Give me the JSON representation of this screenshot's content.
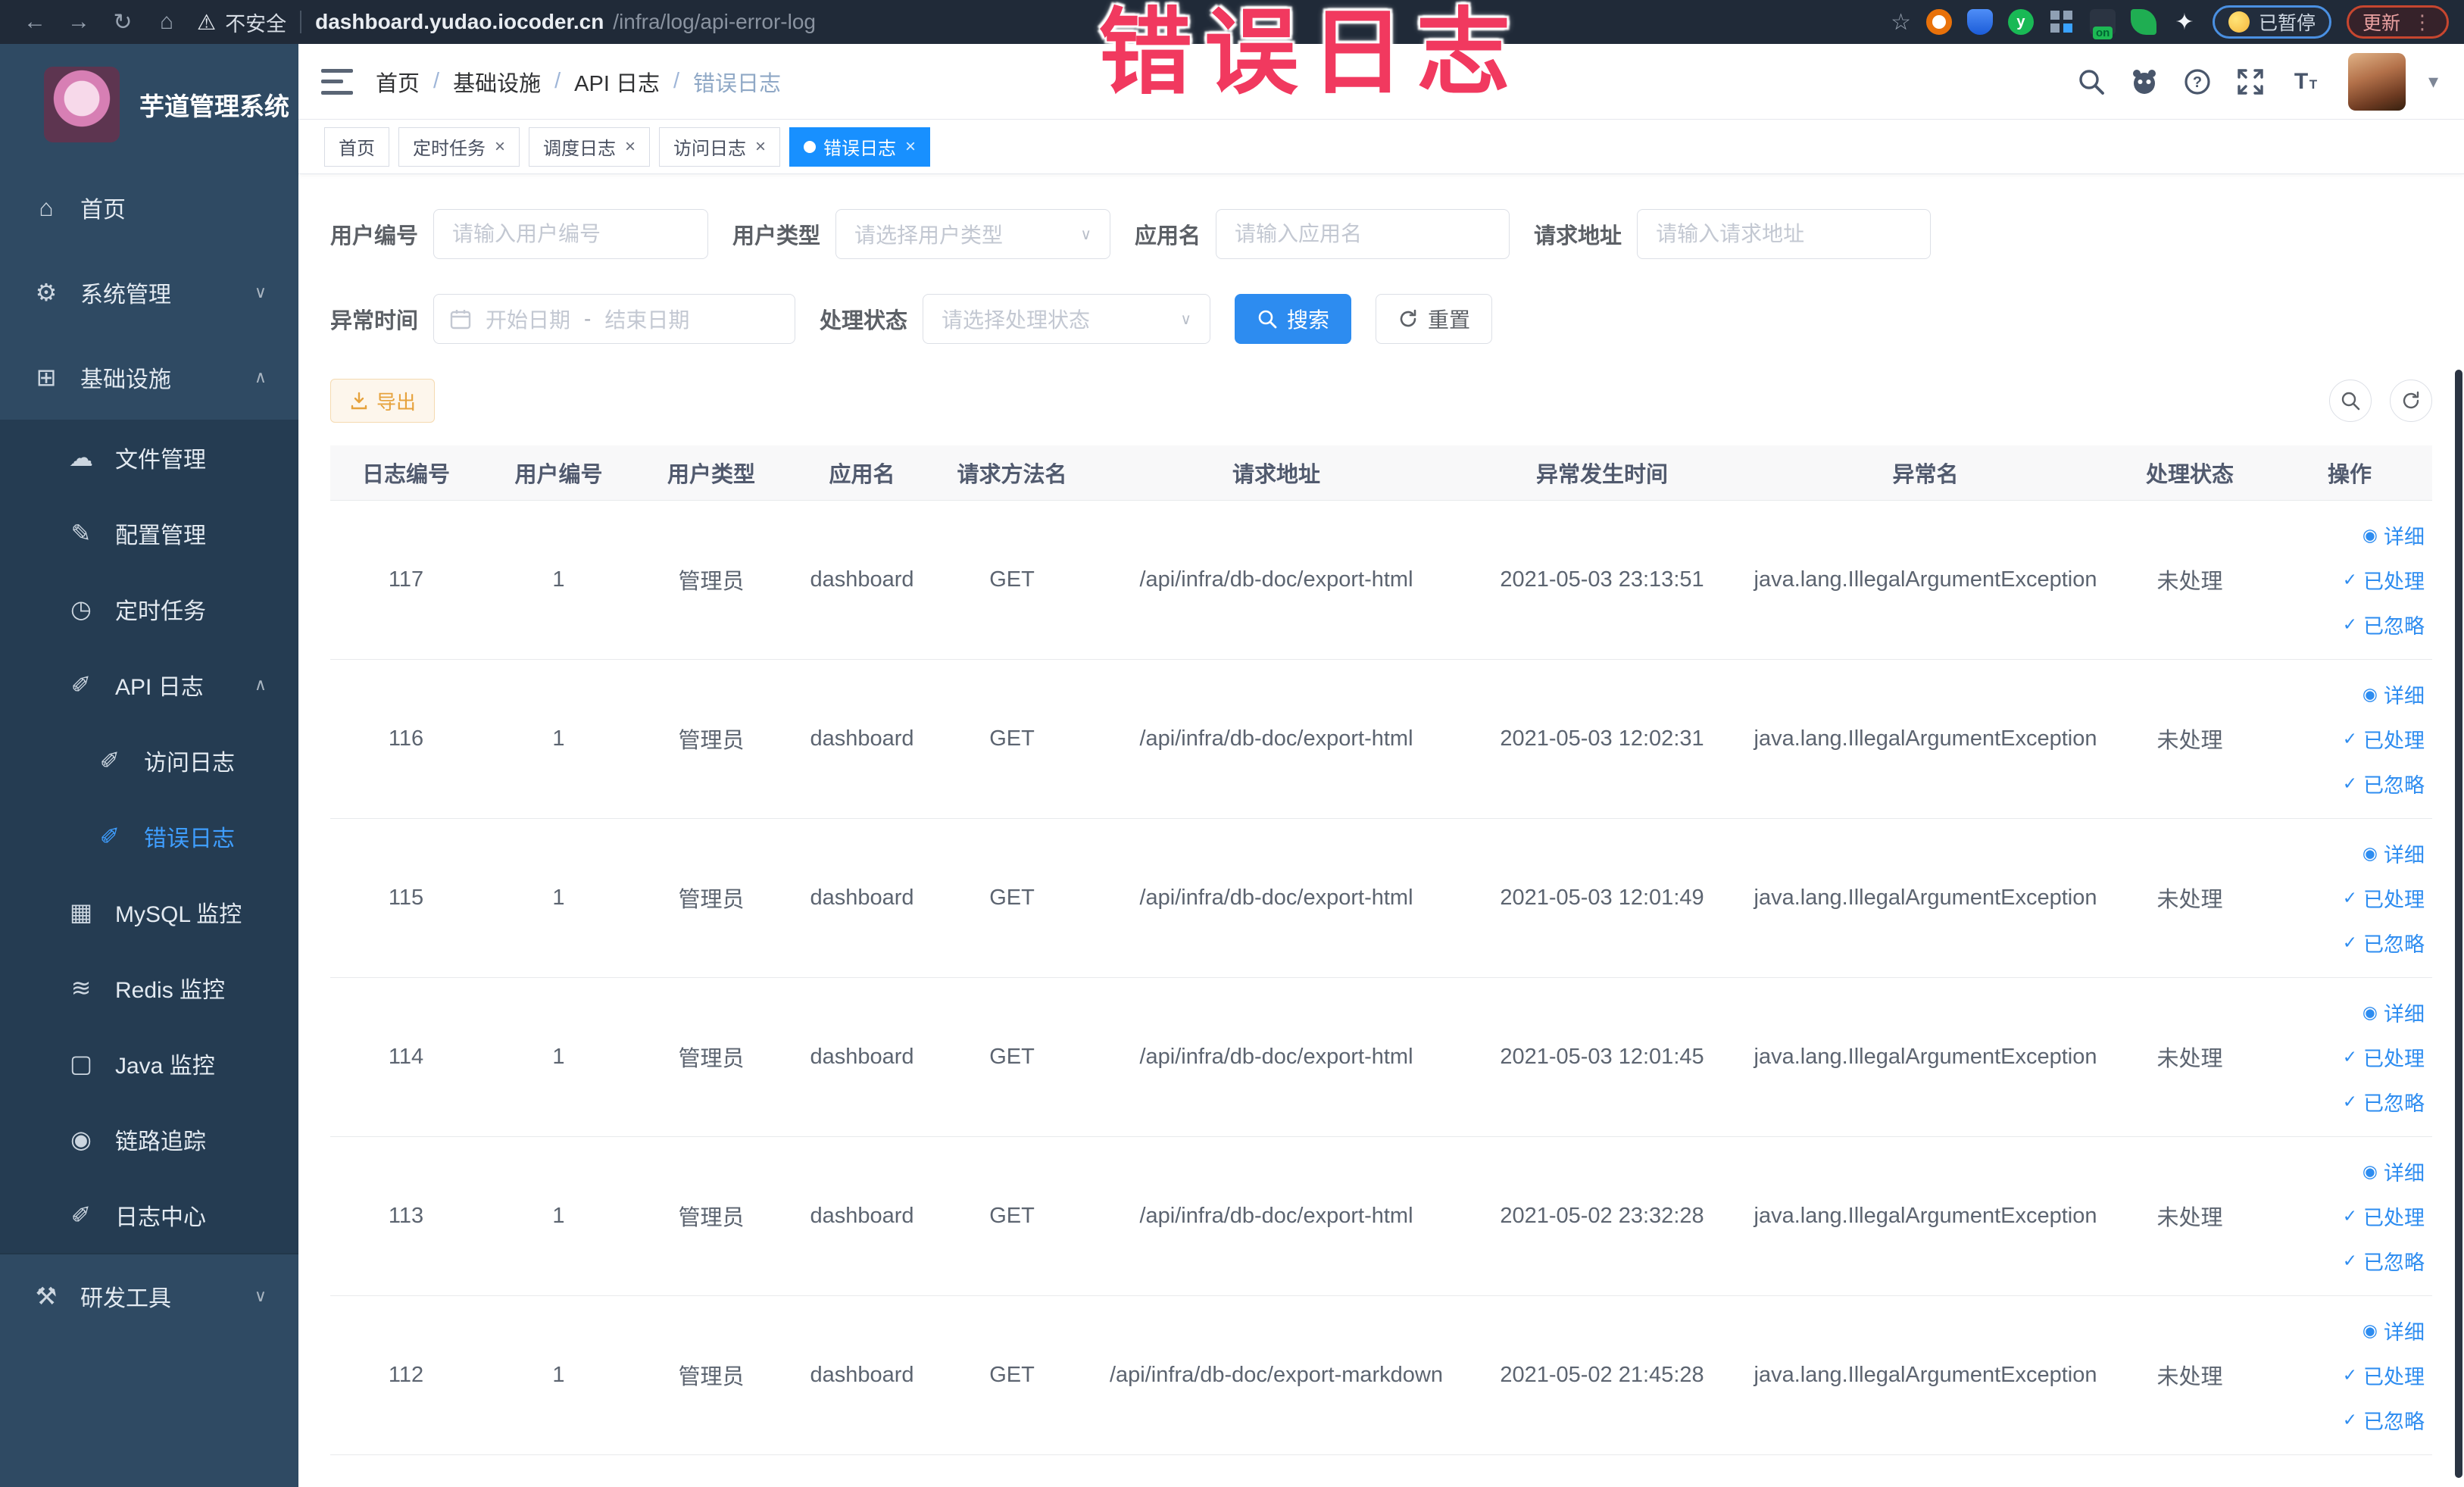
{
  "browser": {
    "security_label": "不安全",
    "url_host": "dashboard.yudao.iocoder.cn",
    "url_path": "/infra/log/api-error-log",
    "paused_label": "已暂停",
    "update_label": "更新",
    "menu_dots": "⋮",
    "star": "☆"
  },
  "overlay_title": "错误日志",
  "sidebar": {
    "app_title": "芋道管理系统",
    "items": [
      {
        "name": "home",
        "label": "首页",
        "icon": "home",
        "level": 0
      },
      {
        "name": "system-management",
        "label": "系统管理",
        "icon": "gear",
        "level": 0,
        "chevron": "down"
      },
      {
        "name": "infrastructure",
        "label": "基础设施",
        "icon": "infra",
        "level": 0,
        "chevron": "up"
      },
      {
        "name": "file-management",
        "label": "文件管理",
        "icon": "cloud",
        "level": 1,
        "sub": true
      },
      {
        "name": "config-management",
        "label": "配置管理",
        "icon": "edit",
        "level": 1,
        "sub": true
      },
      {
        "name": "scheduled-tasks",
        "label": "定时任务",
        "icon": "timer",
        "level": 1,
        "sub": true
      },
      {
        "name": "api-log",
        "label": "API 日志",
        "icon": "log",
        "level": 1,
        "sub": true,
        "chevron": "up"
      },
      {
        "name": "access-log",
        "label": "访问日志",
        "icon": "log",
        "level": 2,
        "sub": true
      },
      {
        "name": "error-log",
        "label": "错误日志",
        "icon": "log",
        "level": 2,
        "sub": true,
        "active": true
      },
      {
        "name": "mysql-monitor",
        "label": "MySQL 监控",
        "icon": "mysql",
        "level": 1,
        "sub": true
      },
      {
        "name": "redis-monitor",
        "label": "Redis 监控",
        "icon": "redis",
        "level": 1,
        "sub": true
      },
      {
        "name": "java-monitor",
        "label": "Java 监控",
        "icon": "java",
        "level": 1,
        "sub": true
      },
      {
        "name": "trace",
        "label": "链路追踪",
        "icon": "eye",
        "level": 1,
        "sub": true
      },
      {
        "name": "log-center",
        "label": "日志中心",
        "icon": "log",
        "level": 1,
        "sub": true
      },
      {
        "name": "dev-tools",
        "label": "研发工具",
        "icon": "tools",
        "level": 0,
        "chevron": "down",
        "divided": true
      }
    ]
  },
  "icon_glyphs": {
    "home": "⌂",
    "gear": "⚙",
    "infra": "⊞",
    "cloud": "☁",
    "edit": "✎",
    "timer": "◷",
    "log": "✐",
    "mysql": "▦",
    "redis": "≋",
    "java": "▢",
    "eye": "◉",
    "tools": "⚒",
    "check": "✓"
  },
  "navbar": {
    "breadcrumb": [
      "首页",
      "基础设施",
      "API 日志",
      "错误日志"
    ]
  },
  "tabs": [
    {
      "label": "首页",
      "closable": false,
      "active": false
    },
    {
      "label": "定时任务",
      "closable": true,
      "active": false
    },
    {
      "label": "调度日志",
      "closable": true,
      "active": false
    },
    {
      "label": "访问日志",
      "closable": true,
      "active": false
    },
    {
      "label": "错误日志",
      "closable": true,
      "active": true
    }
  ],
  "filters": {
    "user_id": {
      "label": "用户编号",
      "placeholder": "请输入用户编号"
    },
    "user_type": {
      "label": "用户类型",
      "placeholder": "请选择用户类型"
    },
    "app_name": {
      "label": "应用名",
      "placeholder": "请输入应用名"
    },
    "request_url": {
      "label": "请求地址",
      "placeholder": "请输入请求地址"
    },
    "error_time": {
      "label": "异常时间",
      "start_placeholder": "开始日期",
      "separator": "-",
      "end_placeholder": "结束日期"
    },
    "process_status": {
      "label": "处理状态",
      "placeholder": "请选择处理状态"
    },
    "search_label": "搜索",
    "reset_label": "重置"
  },
  "toolbar": {
    "export_label": "导出"
  },
  "table": {
    "columns": [
      "日志编号",
      "用户编号",
      "用户类型",
      "应用名",
      "请求方法名",
      "请求地址",
      "异常发生时间",
      "异常名",
      "处理状态",
      "操作"
    ],
    "rows": [
      [
        "117",
        "1",
        "管理员",
        "dashboard",
        "GET",
        "/api/infra/db-doc/export-html",
        "2021-05-03 23:13:51",
        "java.lang.IllegalArgumentException",
        "未处理"
      ],
      [
        "116",
        "1",
        "管理员",
        "dashboard",
        "GET",
        "/api/infra/db-doc/export-html",
        "2021-05-03 12:02:31",
        "java.lang.IllegalArgumentException",
        "未处理"
      ],
      [
        "115",
        "1",
        "管理员",
        "dashboard",
        "GET",
        "/api/infra/db-doc/export-html",
        "2021-05-03 12:01:49",
        "java.lang.IllegalArgumentException",
        "未处理"
      ],
      [
        "114",
        "1",
        "管理员",
        "dashboard",
        "GET",
        "/api/infra/db-doc/export-html",
        "2021-05-03 12:01:45",
        "java.lang.IllegalArgumentException",
        "未处理"
      ],
      [
        "113",
        "1",
        "管理员",
        "dashboard",
        "GET",
        "/api/infra/db-doc/export-html",
        "2021-05-02 23:32:28",
        "java.lang.IllegalArgumentException",
        "未处理"
      ],
      [
        "112",
        "1",
        "管理员",
        "dashboard",
        "GET",
        "/api/infra/db-doc/export-markdown",
        "2021-05-02 21:45:28",
        "java.lang.IllegalArgumentException",
        "未处理"
      ]
    ],
    "row_actions": [
      {
        "label": "详细",
        "icon": "eye"
      },
      {
        "label": "已处理",
        "icon": "check"
      },
      {
        "label": "已忽略",
        "icon": "check"
      }
    ]
  },
  "colors": {
    "primary": "#1890ff",
    "link": "#2d8cf0",
    "warning": "#e6a23c",
    "overlay": "#f1395f",
    "sidebar_bg": "#2f4a63",
    "submenu_bg": "#253c52"
  }
}
